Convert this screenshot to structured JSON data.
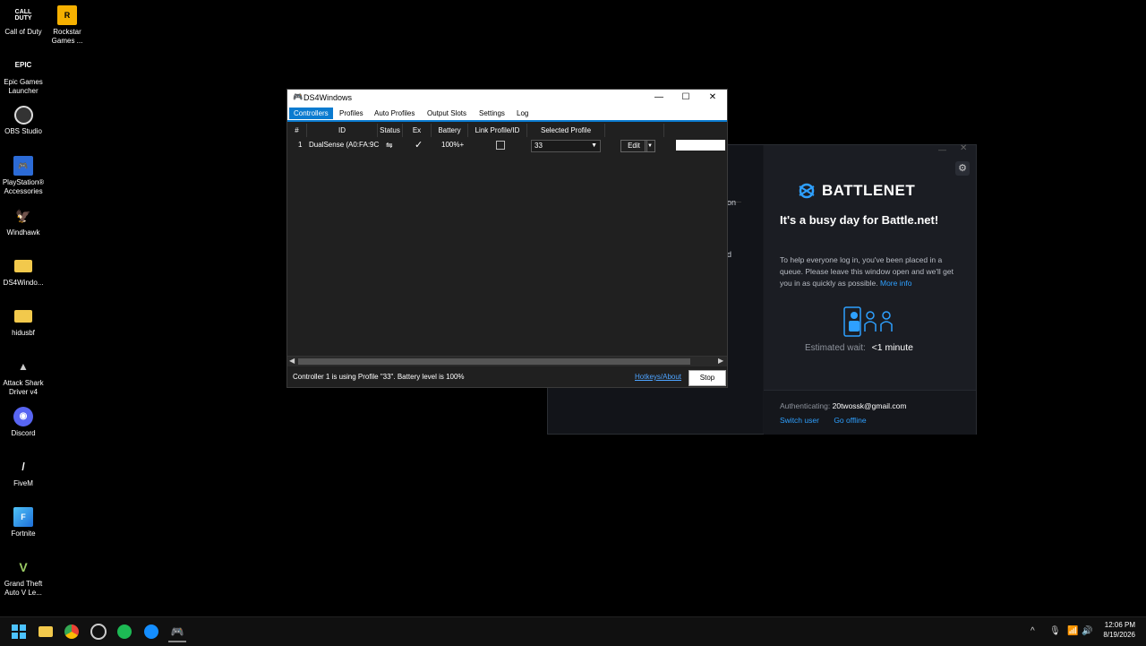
{
  "desktop": {
    "icons": [
      {
        "label": "Call of Duty",
        "icon": "call-of-duty-icon"
      },
      {
        "label": "Rockstar Games ...",
        "icon": "rockstar-icon"
      },
      {
        "label": "Epic Games Launcher",
        "icon": "epic-games-icon"
      },
      {
        "label": "OBS Studio",
        "icon": "obs-icon"
      },
      {
        "label": "PlayStation® Accessories",
        "icon": "playstation-icon"
      },
      {
        "label": "Windhawk",
        "icon": "windhawk-icon"
      },
      {
        "label": "DS4Windo...",
        "icon": "folder-icon"
      },
      {
        "label": "hidusbf",
        "icon": "folder-icon"
      },
      {
        "label": "Attack Shark Driver v4",
        "icon": "attack-shark-icon"
      },
      {
        "label": "Discord",
        "icon": "discord-icon"
      },
      {
        "label": "FiveM",
        "icon": "fivem-icon"
      },
      {
        "label": "Fortnite",
        "icon": "fortnite-icon"
      },
      {
        "label": "Grand Theft Auto V Le...",
        "icon": "gta-icon"
      }
    ]
  },
  "ds4": {
    "title": "DS4Windows",
    "tabs": [
      "Controllers",
      "Profiles",
      "Auto Profiles",
      "Output Slots",
      "Settings",
      "Log"
    ],
    "columns": [
      "#",
      "ID",
      "Status",
      "Ex",
      "Battery",
      "Link Profile/ID",
      "Selected Profile"
    ],
    "row": {
      "num": "1",
      "id": "DualSense (A0:FA:9C",
      "battery": "100%+",
      "profile": "33",
      "edit": "Edit"
    },
    "status_text": "Controller 1 is using Profile \"33\". Battery level is 100%",
    "hotkeys": "Hotkeys/About",
    "stop": "Stop"
  },
  "bnet": {
    "logo": "BATTLENET",
    "title": "It's a busy day for Battle.net!",
    "body": "To help everyone log in, you've been placed in a queue. Please leave this window open and we'll get you in as quickly as possible.",
    "more_info": "More info",
    "wait_label": "Estimated wait:",
    "wait_value": "<1 minute",
    "auth_label": "Authenticating:",
    "auth_email": "20twossk@gmail.com",
    "switch_user": "Switch user",
    "go_offline": "Go offline",
    "partial_1": "on",
    "partial_2": "d"
  },
  "taskbar": {
    "time": "12:06 PM",
    "date": "8/19/2026"
  },
  "colors": {
    "accent": "#0b7bd0",
    "bnet_blue": "#2ea0ff"
  }
}
